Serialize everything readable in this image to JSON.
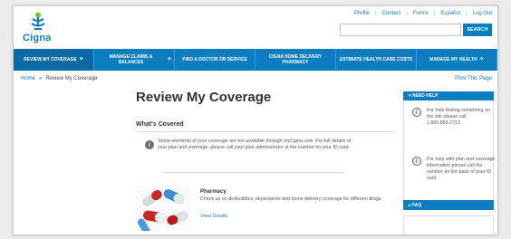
{
  "brand": {
    "name": "Cigna",
    "color": "#0c7dc1"
  },
  "utility": [
    "Profile",
    "Contact",
    "Forms",
    "Español",
    "Log Out"
  ],
  "search": {
    "button": "SEARCH",
    "value": ""
  },
  "nav": [
    {
      "label": "REVIEW MY COVERAGE",
      "plus": "+"
    },
    {
      "label": "MANAGE CLAIMS & BALANCES",
      "plus": "+"
    },
    {
      "label": "FIND A DOCTOR OR SERVICE",
      "plus": ""
    },
    {
      "label": "CIGNA HOME DELIVERY PHARMACY",
      "plus": ""
    },
    {
      "label": "ESTIMATE HEALTH CARE COSTS",
      "plus": ""
    },
    {
      "label": "MANAGE MY HEALTH",
      "plus": "+"
    }
  ],
  "breadcrumb": {
    "home": "Home",
    "sep": "»",
    "current": "Review My Coverage"
  },
  "print": "Print This Page",
  "page": {
    "title": "Review My Coverage",
    "section": "What's Covered",
    "info": "Some elements of your coverage are not available through myCigna.com. For full details of your plan and coverage, please call your plan administrator at the number on your ID card.",
    "pharmacy": {
      "title": "Pharmacy",
      "text": "Check up on deductibles, dependents and home delivery coverage for different drugs",
      "link": "View Details"
    }
  },
  "sidebar": {
    "need_help": "▾ NEED HELP",
    "items": [
      {
        "text": "For help finding something on the site please call 1.800.853.2713"
      },
      {
        "text": "For help with plan and coverage information please call the number on the back of your ID card"
      }
    ],
    "faq": "▸ FAQ"
  }
}
